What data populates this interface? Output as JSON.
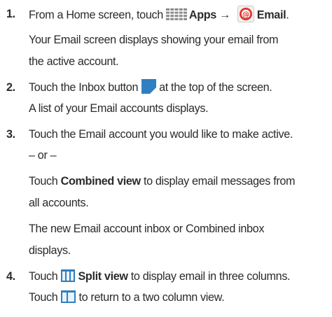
{
  "steps": [
    {
      "number": "1.",
      "line1": {
        "prefix": "From a Home screen, touch",
        "apps_label": "Apps",
        "arrow": "→",
        "email_label": "Email",
        "suffix": "."
      },
      "para": [
        "Your Email screen displays showing your email from",
        "the active account."
      ]
    },
    {
      "number": "2.",
      "line1": {
        "prefix": "Touch the Inbox button",
        "suffix": "at the top of the screen."
      },
      "line2": "A list of your Email accounts displays."
    },
    {
      "number": "3.",
      "line1": "Touch the Email account you would like to make active.",
      "or": "– or –",
      "combined": {
        "prefix": "Touch",
        "bold": "Combined view",
        "suffix": "to display email messages from"
      },
      "combined_line2": "all accounts.",
      "para": [
        "The new Email account inbox or Combined inbox",
        "displays."
      ]
    },
    {
      "number": "4.",
      "line1": {
        "prefix": "Touch",
        "bold": "Split view",
        "suffix": "to display email in three columns."
      },
      "line2": {
        "prefix": "Touch",
        "suffix": "to return to a two column view."
      }
    }
  ],
  "icons": {
    "apps": "apps-grid-icon",
    "email": "email-app-icon",
    "inbox": "inbox-button-icon",
    "split": "split-view-icon",
    "accent_blue": "#2f7fc1",
    "email_red": "#e0322b"
  }
}
